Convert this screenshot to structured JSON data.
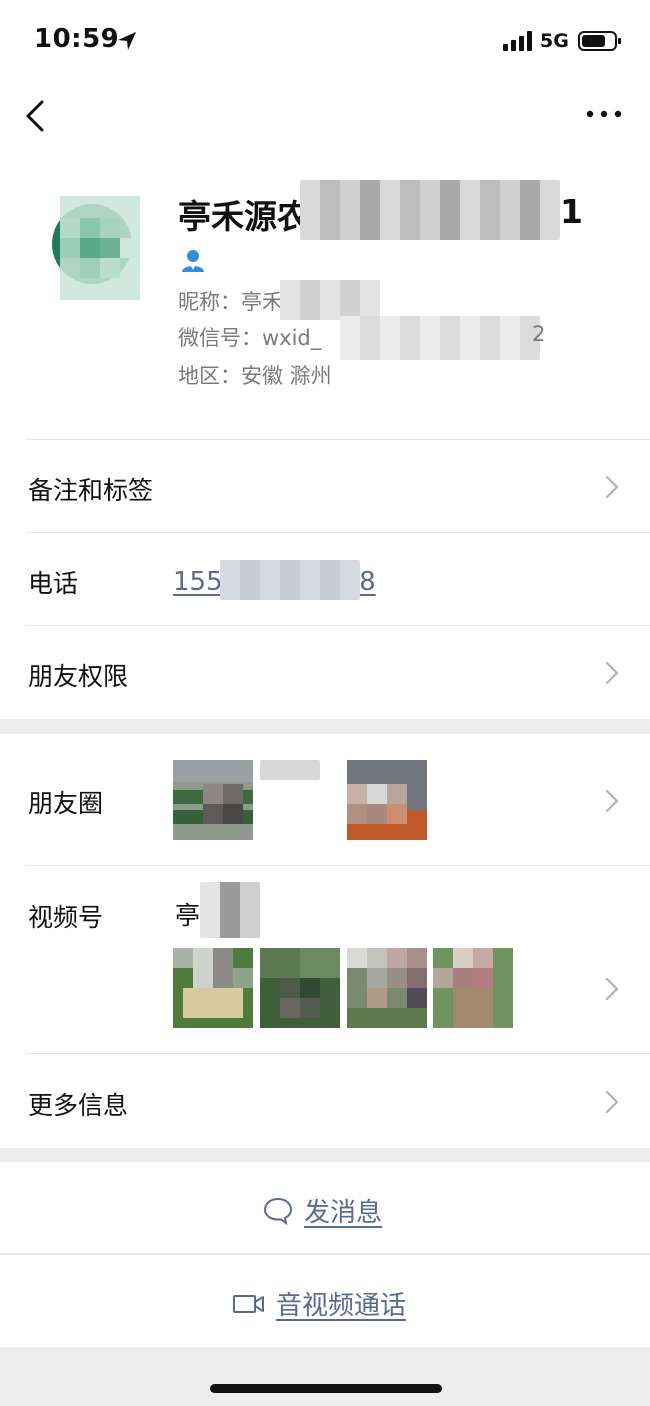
{
  "status_bar": {
    "time": "10:59",
    "network": "5G"
  },
  "profile": {
    "name_visible": "亭禾源农",
    "name_tail": "1",
    "nickname": "昵称：亭禾",
    "wechat_id": "微信号：wxid_",
    "wechat_id_tail": "2",
    "region": "地区：安徽 滁州"
  },
  "rows": {
    "remarks_tags": "备注和标签",
    "phone_label": "电话",
    "phone_value": "1555",
    "phone_tail": "8",
    "friend_permissions": "朋友权限",
    "moments": "朋友圈",
    "channels": "视频号",
    "channels_name": "亭",
    "more_info": "更多信息"
  },
  "actions": {
    "send_message": "发消息",
    "av_call": "音视频通话"
  },
  "colors": {
    "link": "#576b95",
    "background": "#ededed",
    "badge": "#2e8ee0"
  }
}
